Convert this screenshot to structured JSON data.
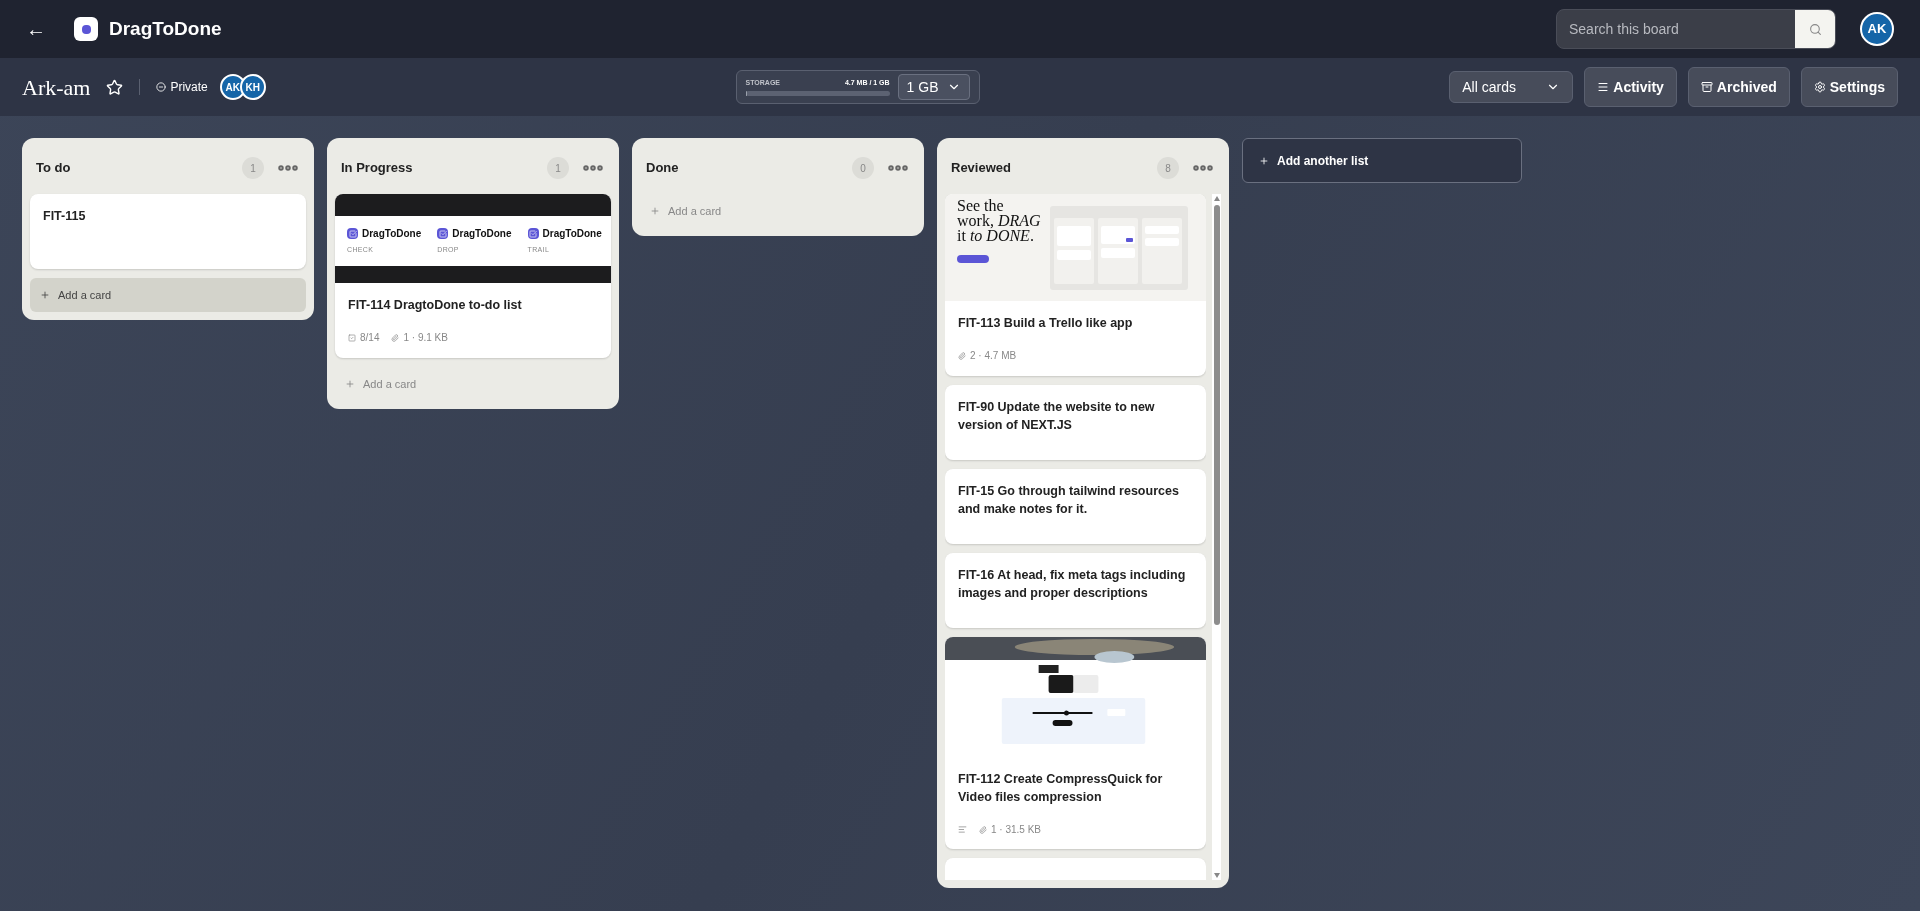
{
  "topbar": {
    "back": "←",
    "app_name": "DragToDone",
    "search": {
      "placeholder": "Search this board"
    },
    "user_avatar": "AK"
  },
  "board_bar": {
    "title": "Ark-am",
    "starred": false,
    "visibility": "Private",
    "members": [
      "AK",
      "KH"
    ],
    "storage": {
      "label": "STORAGE",
      "reading": "4.7 MB / 1 GB",
      "level": 0.005,
      "plan": "1 GB"
    },
    "filter": "All cards",
    "buttons": [
      {
        "kind": "activity",
        "label": "Activity"
      },
      {
        "kind": "archive",
        "label": "Archived"
      },
      {
        "kind": "settings",
        "label": "Settings"
      }
    ]
  },
  "lists": [
    {
      "title": "To do",
      "count": "1",
      "cards": [
        {
          "title": "FIT-115"
        }
      ],
      "add_card": {
        "label": "Add a card",
        "highlighted": true
      }
    },
    {
      "title": "In Progress",
      "count": "1",
      "cards": [
        {
          "title": "FIT-114 DragtoDone to-do list",
          "thumbnail": {
            "kind": "app-preview",
            "items": [
              {
                "name": "DragToDone",
                "caption": "CHECK"
              },
              {
                "name": "DragToDone",
                "caption": "DROP"
              },
              {
                "name": "DragToDone",
                "caption": "TRAIL"
              }
            ]
          },
          "checklist": "8/14",
          "attachments": "1 · 9.1 KB"
        }
      ],
      "add_card": {
        "label": "Add a card",
        "highlighted": false
      }
    },
    {
      "title": "Done",
      "count": "0",
      "add_card": {
        "label": "Add a card",
        "highlighted": false
      }
    },
    {
      "title": "Reviewed",
      "count": "8",
      "scrollable": true,
      "cards": [
        {
          "title": "FIT-113 Build a Trello like app",
          "thumbnail": {
            "kind": "landing",
            "headline": "See the work, *DRAG* it *to DONE*."
          },
          "attachments": "2 · 4.7 MB"
        },
        {
          "title": "FIT-90 Update the website to new version of NEXT.JS"
        },
        {
          "title": "FIT-15 Go through tailwind resources and make notes for it."
        },
        {
          "title": "FIT-16 At head, fix meta tags including images and proper descriptions"
        },
        {
          "title": "FIT-112 Create CompressQuick for Video files compression",
          "has_description": true,
          "attachments": "1 · 31.5 KB"
        }
      ],
      "more_below": true
    }
  ],
  "add_list": "Add another list"
}
